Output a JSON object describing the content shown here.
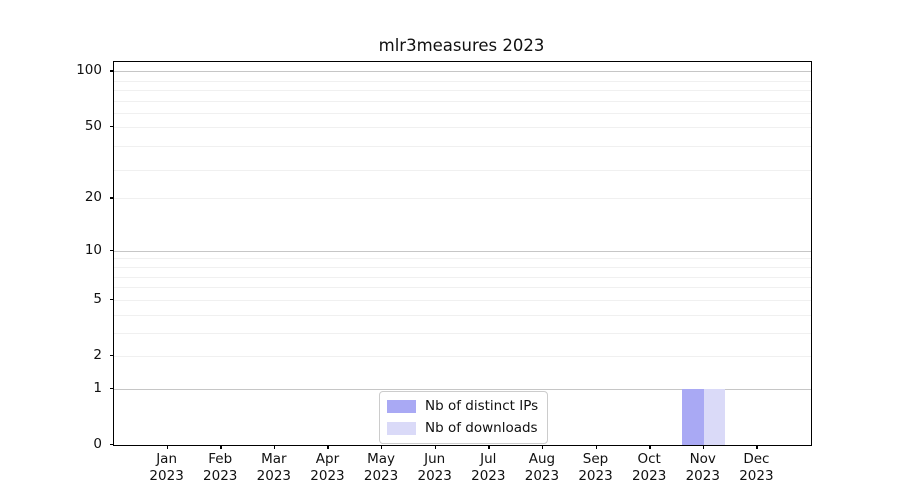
{
  "chart_data": {
    "type": "bar",
    "title": "mlr3measures 2023",
    "categories": [
      "Jan",
      "Feb",
      "Mar",
      "Apr",
      "May",
      "Jun",
      "Jul",
      "Aug",
      "Sep",
      "Oct",
      "Nov",
      "Dec"
    ],
    "category_year": "2023",
    "series": [
      {
        "name": "Nb of distinct IPs",
        "color": "#a9a9f4",
        "values": [
          0,
          0,
          0,
          0,
          0,
          0,
          0,
          0,
          0,
          0,
          1,
          0
        ]
      },
      {
        "name": "Nb of downloads",
        "color": "#dadaf8",
        "values": [
          0,
          0,
          0,
          0,
          0,
          0,
          0,
          0,
          0,
          0,
          1,
          0
        ]
      }
    ],
    "xlabel": "",
    "ylabel": "",
    "y_scale": "log1p",
    "ylim": [
      0,
      112
    ],
    "y_ticks": [
      0,
      1,
      2,
      5,
      10,
      20,
      50,
      100
    ],
    "grid": {
      "on": true,
      "major_values": [
        1,
        10,
        100
      ],
      "minor_values": [
        2,
        3,
        4,
        5,
        6,
        7,
        8,
        9,
        20,
        29,
        39,
        50,
        59,
        69,
        79,
        89
      ]
    },
    "legend_position": "lower center inside axes"
  },
  "colors": {
    "bar_distinct_ips": "#a9a9f4",
    "bar_downloads": "#dadaf8",
    "major_grid": "#c6c6c6",
    "minor_grid": "#f0f0f0",
    "axis_frame": "#000000",
    "legend_border": "#cccccc",
    "text": "#111111"
  }
}
